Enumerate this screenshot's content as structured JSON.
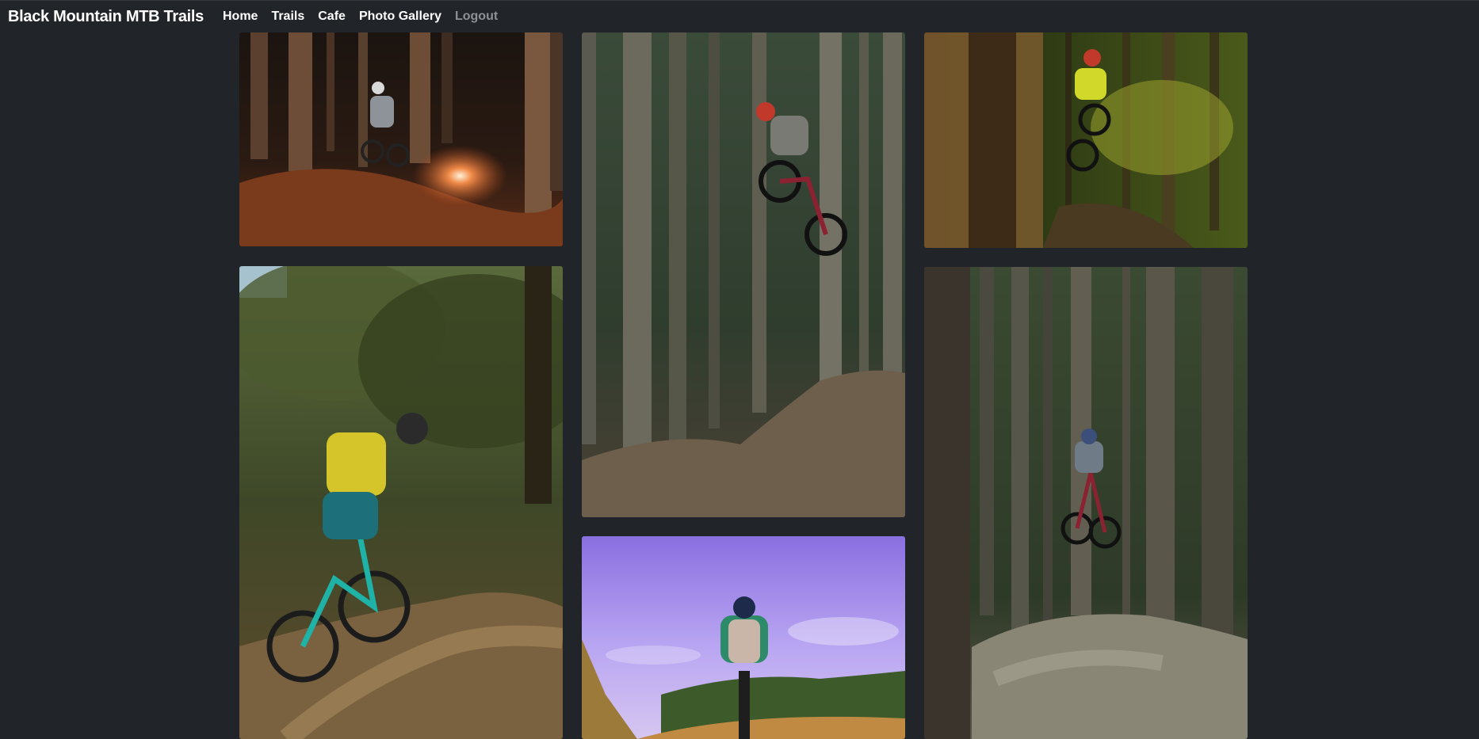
{
  "navbar": {
    "brand": "Black Mountain MTB Trails",
    "links": [
      {
        "label": "Home"
      },
      {
        "label": "Trails"
      },
      {
        "label": "Cafe"
      },
      {
        "label": "Photo Gallery"
      },
      {
        "label": "Logout"
      }
    ]
  },
  "gallery": {
    "photos": [
      {
        "subject": "rider-dusty-forest-turn-photo"
      },
      {
        "subject": "rider-forest-jump-photo"
      },
      {
        "subject": "rider-yellow-forest-jump-photo"
      },
      {
        "subject": "rider-trail-descent-photo"
      },
      {
        "subject": "rider-tall-trees-jump-photo"
      },
      {
        "subject": "rider-purple-sky-photo"
      }
    ]
  },
  "colors": {
    "background": "#212529",
    "nav_text": "#ffffff",
    "nav_muted": "#8d9196"
  }
}
